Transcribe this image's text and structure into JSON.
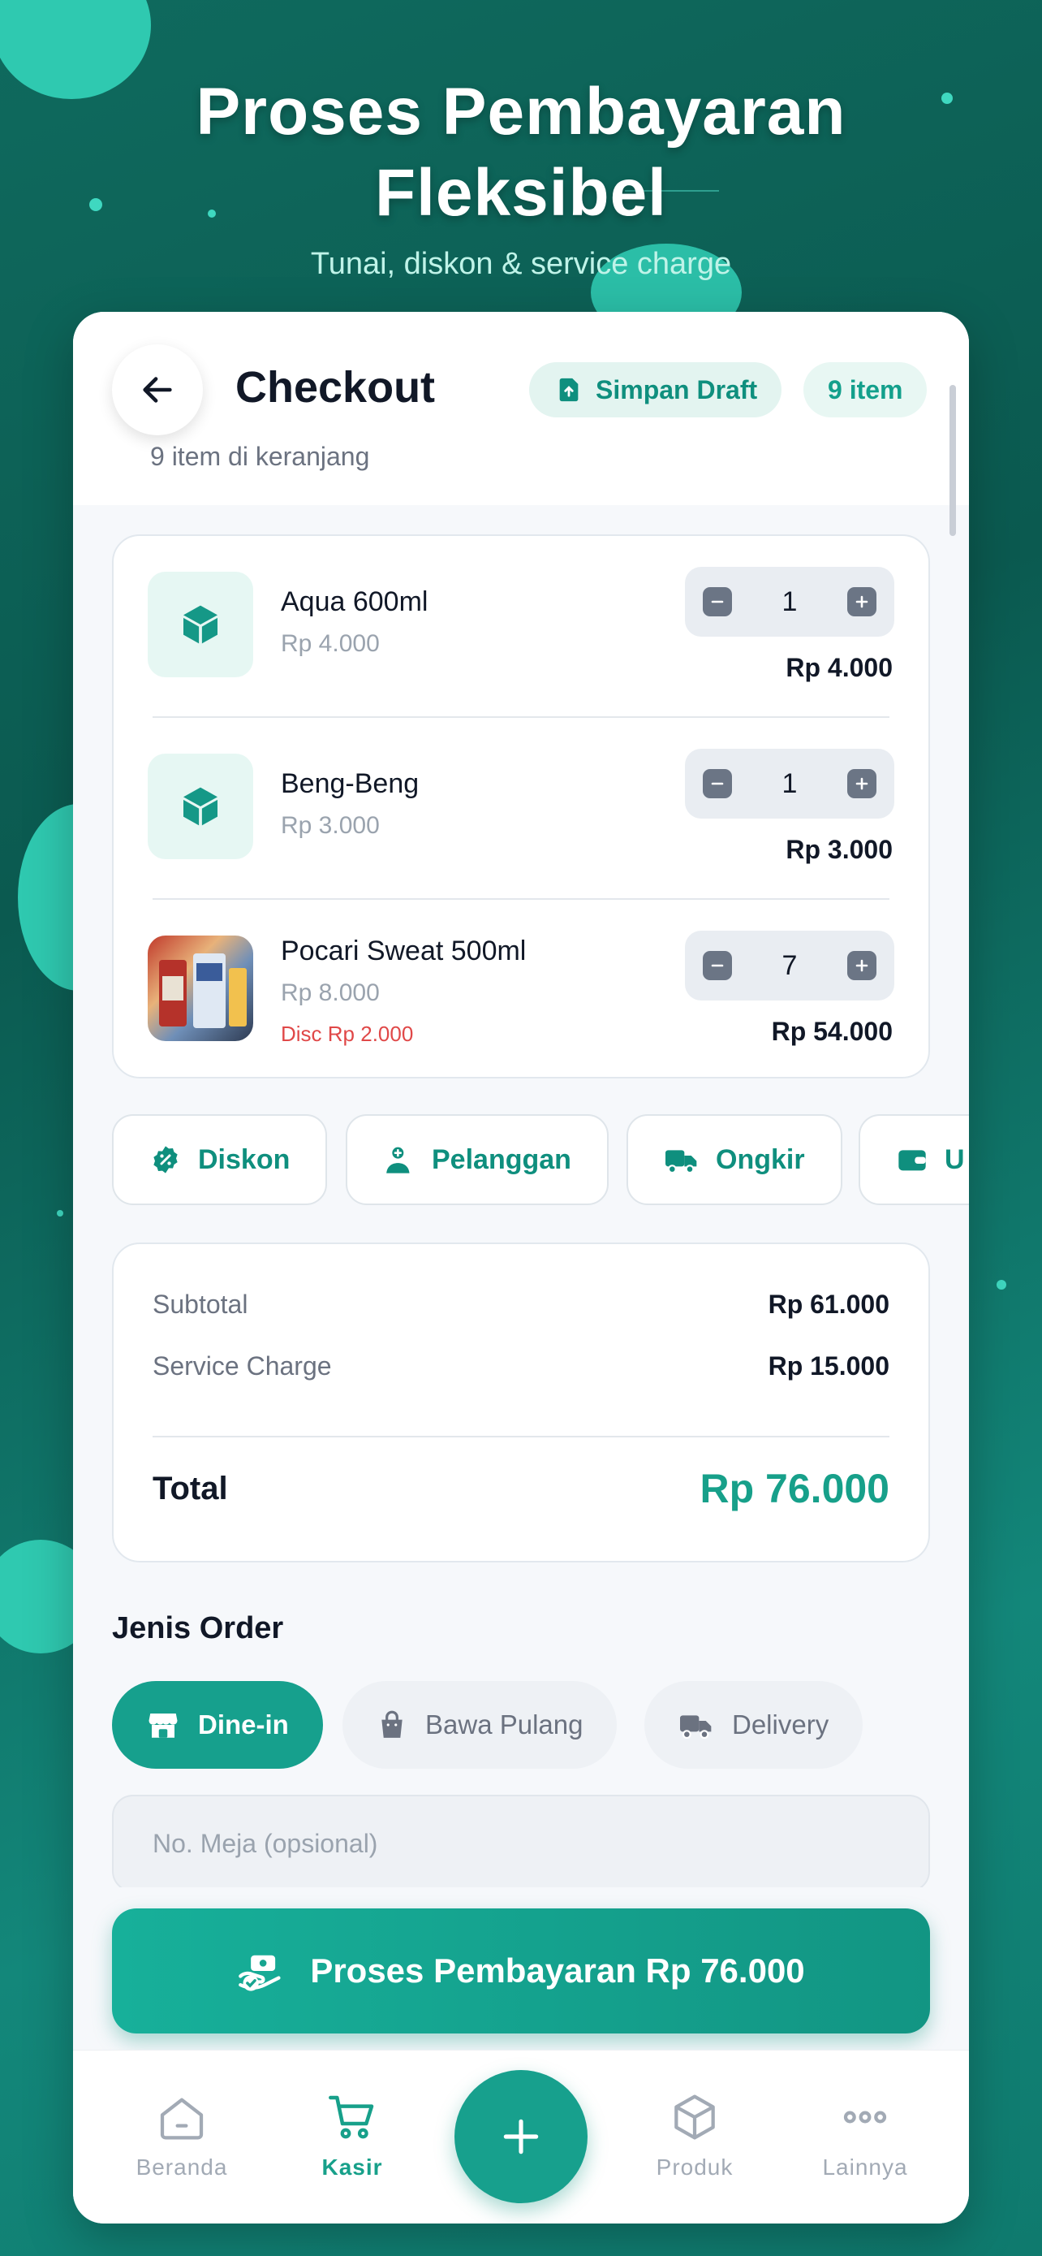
{
  "hero": {
    "title_line1": "Proses Pembayaran",
    "title_line2": "Fleksibel",
    "subtitle": "Tunai, diskon & service charge"
  },
  "header": {
    "title": "Checkout",
    "subtitle": "9 item di keranjang",
    "draft_label": "Simpan Draft",
    "count_label": "9 item"
  },
  "cart": {
    "items": [
      {
        "name": "Aqua 600ml",
        "price": "Rp 4.000",
        "qty": "1",
        "total": "Rp 4.000",
        "icon": "cube-icon"
      },
      {
        "name": "Beng-Beng",
        "price": "Rp 3.000",
        "qty": "1",
        "total": "Rp 3.000",
        "icon": "cube-icon"
      },
      {
        "name": "Pocari Sweat 500ml",
        "price": "Rp 8.000",
        "discount": "Disc Rp 2.000",
        "qty": "7",
        "total": "Rp 54.000",
        "icon": "product-photo"
      }
    ]
  },
  "actions": [
    {
      "label": "Diskon",
      "icon": "discount-badge-icon"
    },
    {
      "label": "Pelanggan",
      "icon": "add-person-icon"
    },
    {
      "label": "Ongkir",
      "icon": "truck-icon"
    },
    {
      "label": "U",
      "icon": "wallet-icon"
    }
  ],
  "summary": {
    "subtotal_label": "Subtotal",
    "subtotal_value": "Rp 61.000",
    "service_label": "Service Charge",
    "service_value": "Rp 15.000",
    "total_label": "Total",
    "total_value": "Rp 76.000"
  },
  "order_type": {
    "label": "Jenis Order",
    "options": [
      {
        "label": "Dine-in",
        "icon": "store-icon",
        "selected": true
      },
      {
        "label": "Bawa Pulang",
        "icon": "bag-icon",
        "selected": false
      },
      {
        "label": "Delivery",
        "icon": "truck-icon",
        "selected": false
      }
    ],
    "table_placeholder": "No. Meja (opsional)"
  },
  "pay_button": {
    "label": "Proses Pembayaran Rp 76.000",
    "icon": "cash-hand-icon"
  },
  "nav": {
    "items": [
      {
        "label": "Beranda",
        "icon": "home-icon",
        "active": false
      },
      {
        "label": "Kasir",
        "icon": "cart-icon",
        "active": true
      },
      {
        "label": "Produk",
        "icon": "box-icon",
        "active": false
      },
      {
        "label": "Lainnya",
        "icon": "more-icon",
        "active": false
      }
    ],
    "fab_icon": "plus-icon"
  },
  "colors": {
    "accent": "#17a08d",
    "background": "#0f6a5e",
    "discount": "#e04848"
  }
}
